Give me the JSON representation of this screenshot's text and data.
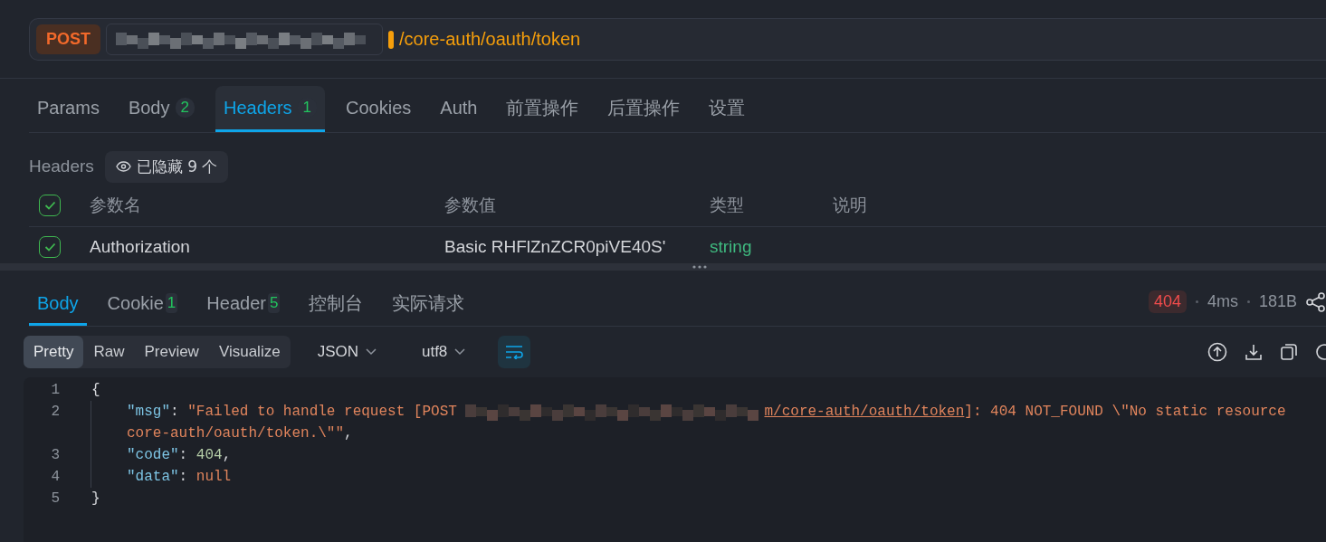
{
  "request": {
    "method": "POST",
    "path": "/core-auth/oauth/token"
  },
  "request_tabs": [
    {
      "label": "Params",
      "selected": false
    },
    {
      "label": "Body",
      "count": "2",
      "selected": false
    },
    {
      "label": "Headers",
      "count": "1",
      "selected": true
    },
    {
      "label": "Cookies",
      "selected": false
    },
    {
      "label": "Auth",
      "selected": false
    },
    {
      "label": "前置操作",
      "selected": false
    },
    {
      "label": "后置操作",
      "selected": false
    },
    {
      "label": "设置",
      "selected": false
    }
  ],
  "headers_section": {
    "title": "Headers",
    "hidden_label": "已隐藏 9 个"
  },
  "params_table": {
    "all_checked": true,
    "columns": [
      "参数名",
      "参数值",
      "类型",
      "说明"
    ],
    "rows": [
      {
        "checked": true,
        "name": "Authorization",
        "value": "Basic RHFlZnZCR0piVE40S'",
        "type": "string"
      }
    ]
  },
  "response_tabs": [
    {
      "label": "Body",
      "selected": true
    },
    {
      "label": "Cookie",
      "count": "1",
      "selected": false
    },
    {
      "label": "Header",
      "count": "5",
      "selected": false
    },
    {
      "label": "控制台",
      "selected": false
    },
    {
      "label": "实际请求",
      "selected": false
    }
  ],
  "response_status": {
    "code": "404",
    "time": "4ms",
    "size": "181B"
  },
  "view_modes": [
    {
      "label": "Pretty",
      "selected": true
    },
    {
      "label": "Raw",
      "selected": false
    },
    {
      "label": "Preview",
      "selected": false
    },
    {
      "label": "Visualize",
      "selected": false
    }
  ],
  "format_select": "JSON",
  "encoding_select": "utf8",
  "code_lines": [
    {
      "number": "1",
      "indent": false,
      "segments": [
        {
          "kind": "punct",
          "text": "{"
        }
      ]
    },
    {
      "number": "2",
      "indent": true,
      "segments": [
        {
          "kind": "key",
          "text": "\"msg\""
        },
        {
          "kind": "punct",
          "text": ": "
        },
        {
          "kind": "string",
          "text": "\"Failed to handle request [POST "
        },
        {
          "kind": "redacted"
        },
        {
          "kind": "link",
          "text": "m/core-auth/oauth/token"
        },
        {
          "kind": "string",
          "text": "]: 404 NOT_FOUND \\\"No static resource"
        }
      ],
      "wrap": [
        {
          "kind": "string",
          "text": "core-auth/oauth/token.\\\"\""
        },
        {
          "kind": "punct",
          "text": ","
        }
      ]
    },
    {
      "number": "3",
      "indent": true,
      "segments": [
        {
          "kind": "key",
          "text": "\"code\""
        },
        {
          "kind": "punct",
          "text": ": "
        },
        {
          "kind": "number",
          "text": "404"
        },
        {
          "kind": "punct",
          "text": ","
        }
      ]
    },
    {
      "number": "4",
      "indent": true,
      "segments": [
        {
          "kind": "key",
          "text": "\"data\""
        },
        {
          "kind": "punct",
          "text": ": "
        },
        {
          "kind": "null",
          "text": "null"
        }
      ]
    },
    {
      "number": "5",
      "indent": false,
      "segments": [
        {
          "kind": "punct",
          "text": "}"
        }
      ]
    }
  ]
}
